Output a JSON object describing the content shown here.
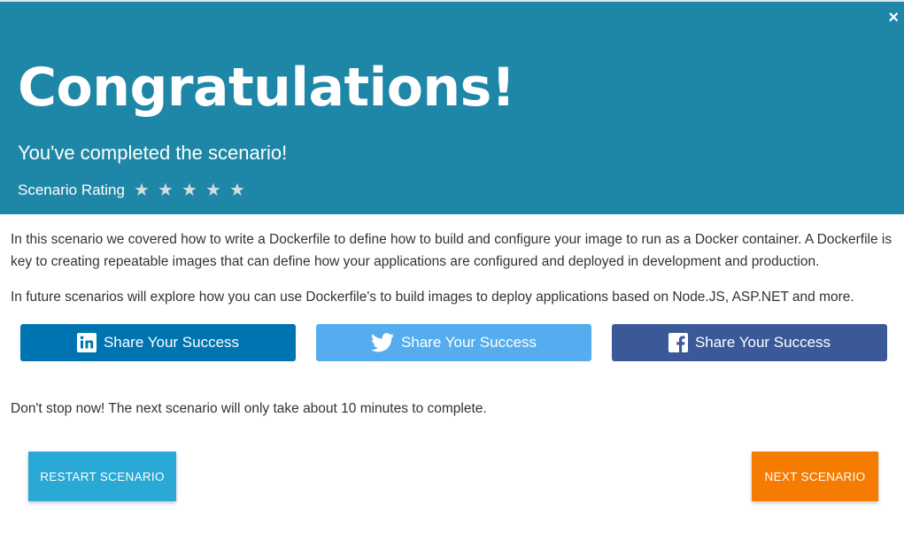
{
  "header": {
    "close_label": "×",
    "title": "Congratulations!",
    "subtitle": "You've completed the scenario!",
    "rating_label": "Scenario Rating",
    "star_glyph": "★",
    "star_count": 5
  },
  "body": {
    "paragraph1": "In this scenario we covered how to write a Dockerfile to define how to build and configure your image to run as a Docker container. A Dockerfile is key to creating repeatable images that can define how your applications are configured and deployed in development and production.",
    "paragraph2": "In future scenarios will explore how you can use Dockerfile's to build images to deploy applications based on Node.JS, ASP.NET and more.",
    "paragraph3": "Don't stop now! The next scenario will only take about 10 minutes to complete."
  },
  "share": {
    "linkedin": {
      "label": "Share Your Success",
      "icon": "linkedin-icon",
      "color": "#0073b1"
    },
    "twitter": {
      "label": "Share Your Success",
      "icon": "twitter-icon",
      "color": "#55acee"
    },
    "facebook": {
      "label": "Share Your Success",
      "icon": "facebook-icon",
      "color": "#3b5998"
    }
  },
  "actions": {
    "restart_label": "RESTART SCENARIO",
    "next_label": "NEXT SCENARIO"
  },
  "colors": {
    "header_bg": "#1e86a6",
    "restart_bg": "#2aa8d6",
    "next_bg": "#f57c00"
  }
}
